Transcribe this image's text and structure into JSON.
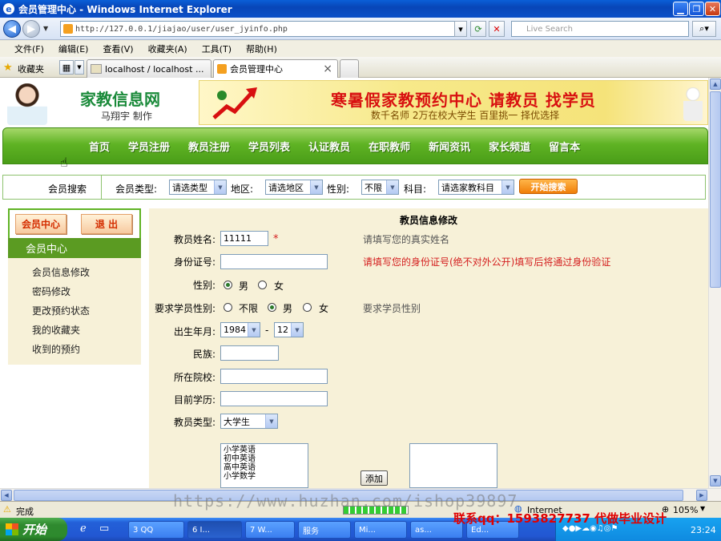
{
  "window": {
    "title": "会员管理中心 - Windows Internet Explorer"
  },
  "browser": {
    "url": "http://127.0.0.1/jiajao/user/user_jyinfo.php",
    "search_placeholder": "Live Search",
    "menu": [
      "文件(F)",
      "编辑(E)",
      "查看(V)",
      "收藏夹(A)",
      "工具(T)",
      "帮助(H)"
    ],
    "favorites_label": "收藏夹",
    "tabs": [
      {
        "label": "localhost / localhost ..."
      },
      {
        "label": "会员管理中心"
      }
    ],
    "tab_close": "×"
  },
  "header": {
    "logo_title": "家教信息网",
    "logo_sub": "马翔宇 制作",
    "banner_main": "寒暑假家教预约中心 请教员 找学员",
    "banner_sub": "数千名师 2万在校大学生 百里挑一 择优选择"
  },
  "nav": [
    "首页",
    "学员注册",
    "教员注册",
    "学员列表",
    "认证教员",
    "在职教师",
    "新闻资讯",
    "家长频道",
    "留言本"
  ],
  "search_bar": {
    "title": "会员搜索",
    "type_label": "会员类型:",
    "type_value": "请选类型",
    "area_label": "地区:",
    "area_value": "请选地区",
    "gender_label": "性别:",
    "gender_value": "不限",
    "subject_label": "科目:",
    "subject_value": "请选家教科目",
    "button": "开始搜索"
  },
  "sidebar": {
    "member_btn": "会员中心",
    "logout_btn": "退 出",
    "heading": "会员中心",
    "items": [
      "会员信息修改",
      "密码修改",
      "更改预约状态",
      "我的收藏夹",
      "收到的预约"
    ]
  },
  "form": {
    "title": "教员信息修改",
    "name_label": "教员姓名:",
    "name_value": "11111",
    "required_mark": "*",
    "name_hint": "请填写您的真实姓名",
    "id_label": "身份证号:",
    "id_hint": "请填写您的身份证号(绝不对外公开)填写后将通过身份验证",
    "gender_label": "性别:",
    "gender_options": [
      "男",
      "女"
    ],
    "gender_selected": "男",
    "student_gender_label": "要求学员性别:",
    "student_gender_options": [
      "不限",
      "男",
      "女"
    ],
    "student_gender_selected": "男",
    "student_gender_hint": "要求学员性别",
    "birth_label": "出生年月:",
    "birth_year": "1984",
    "birth_sep": "-",
    "birth_month": "12",
    "ethnicity_label": "民族:",
    "school_label": "所在院校:",
    "education_label": "目前学历:",
    "teacher_type_label": "教员类型:",
    "teacher_type_value": "大学生",
    "subjects": [
      "小学英语",
      "初中英语",
      "高中英语",
      "小学数学"
    ],
    "add_button": "添加"
  },
  "statusbar": {
    "status": "完成",
    "zone": "Internet",
    "zoom": "105%"
  },
  "taskbar": {
    "start": "开始",
    "tasks": [
      "3 QQ",
      "6 I...",
      "7 W...",
      "服务",
      "Mi...",
      "as...",
      "Ed..."
    ],
    "clock": "23:24"
  },
  "watermark": {
    "text": "https://www.huzhan.com/ishop39897",
    "qq": "联系qq：1593827737 代做毕业设计"
  }
}
